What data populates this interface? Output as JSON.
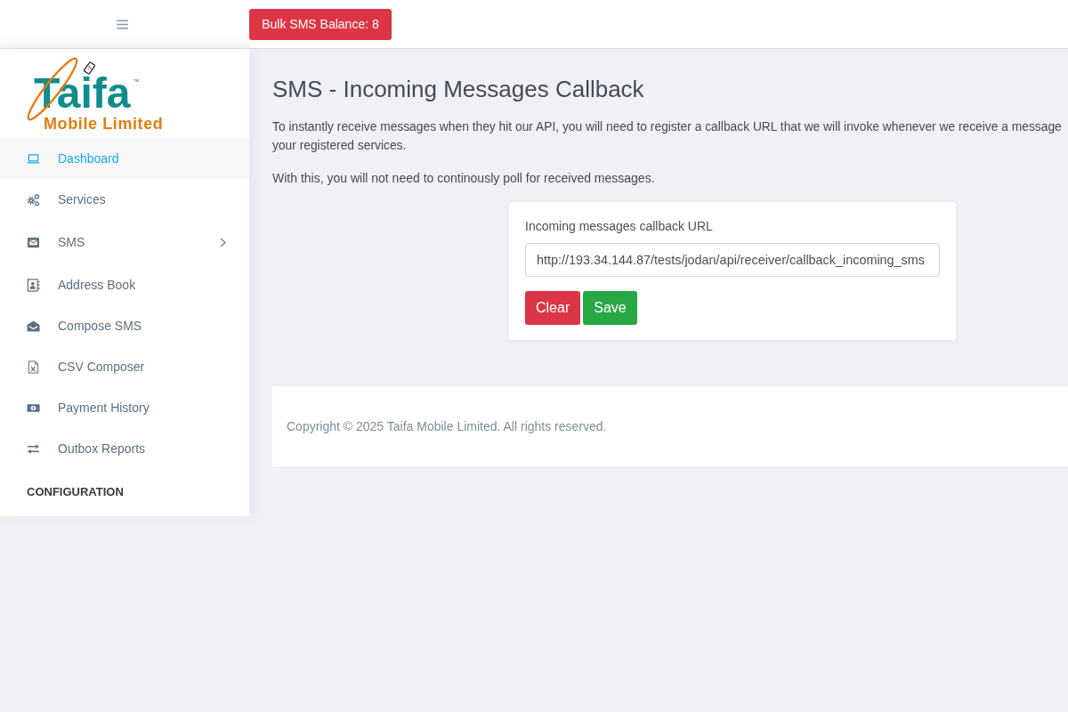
{
  "top_bar": {
    "balance_button": {
      "label": "Bulk SMS Balance: 8"
    }
  },
  "sidebar": {
    "logo": {
      "wordmark": "Taifa",
      "trademark": "™",
      "tagline": "Mobile Limited"
    },
    "items": [
      {
        "label": "Dashboard",
        "kind": "link",
        "selected": true
      },
      {
        "label": "Services",
        "kind": "link",
        "selected": false
      },
      {
        "label": "SMS",
        "kind": "group",
        "selected": false
      },
      {
        "label": "Address Book",
        "kind": "link",
        "selected": false
      },
      {
        "label": "Compose SMS",
        "kind": "link",
        "selected": false
      },
      {
        "label": "CSV Composer",
        "kind": "link",
        "selected": false
      },
      {
        "label": "Payment History",
        "kind": "link",
        "selected": false
      },
      {
        "label": "Outbox Reports",
        "kind": "link",
        "selected": false
      }
    ],
    "section_heading": "CONFIGURATION"
  },
  "page": {
    "title": "SMS - Incoming Messages Callback",
    "intro_lines": [
      "To instantly receive messages when they hit our API, you will need to register a callback URL that we will invoke whenever we receive a message",
      "your registered services."
    ],
    "note": "With this, you will not need to continously poll for received messages.",
    "form": {
      "label": "Incoming messages callback URL",
      "url_field": {
        "value": "http://193.34.144.87/tests/jodan/api/receiver/callback_incoming_sms"
      },
      "buttons": [
        {
          "label": "Clear",
          "kind": "danger"
        },
        {
          "label": "Save",
          "kind": "success"
        }
      ]
    }
  },
  "footer": {
    "text": "Copyright © 2025 Taifa Mobile Limited. All rights reserved."
  }
}
